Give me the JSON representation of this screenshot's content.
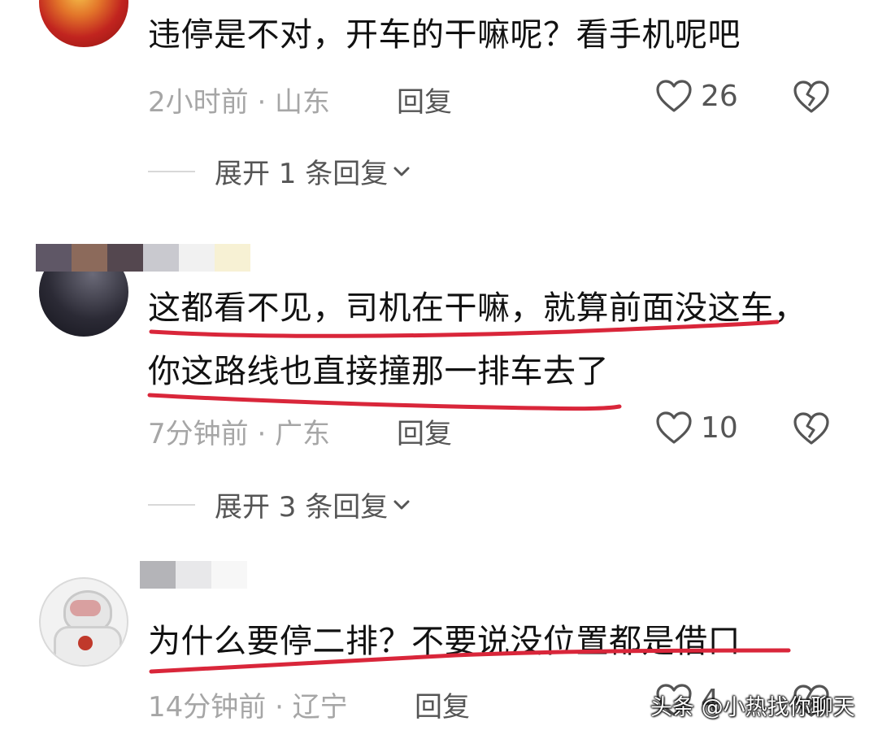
{
  "comments": [
    {
      "text": "违停是不对，开车的干嘛呢？看手机呢吧",
      "meta": "2小时前 · 山东",
      "reply_label": "回复",
      "likes": "26",
      "expand": "展开 1 条回复"
    },
    {
      "text_line1": "这都看不见，司机在干嘛，就算前面没这车，",
      "text_line2": "你这路线也直接撞那一排车去了",
      "meta": "7分钟前 · 广东",
      "reply_label": "回复",
      "likes": "10",
      "expand": "展开 3 条回复"
    },
    {
      "text": "为什么要停二排？不要说没位置都是借口",
      "meta": "14分钟前 · 辽宁",
      "reply_label": "回复",
      "likes": "4"
    }
  ],
  "watermark": "头条 @小热找你聊天",
  "colors": {
    "underline": "#d9263a",
    "meta": "#a6a6a6",
    "action": "#555555"
  },
  "icons": [
    "heart-icon",
    "broken-heart-icon",
    "chevron-down-icon"
  ]
}
